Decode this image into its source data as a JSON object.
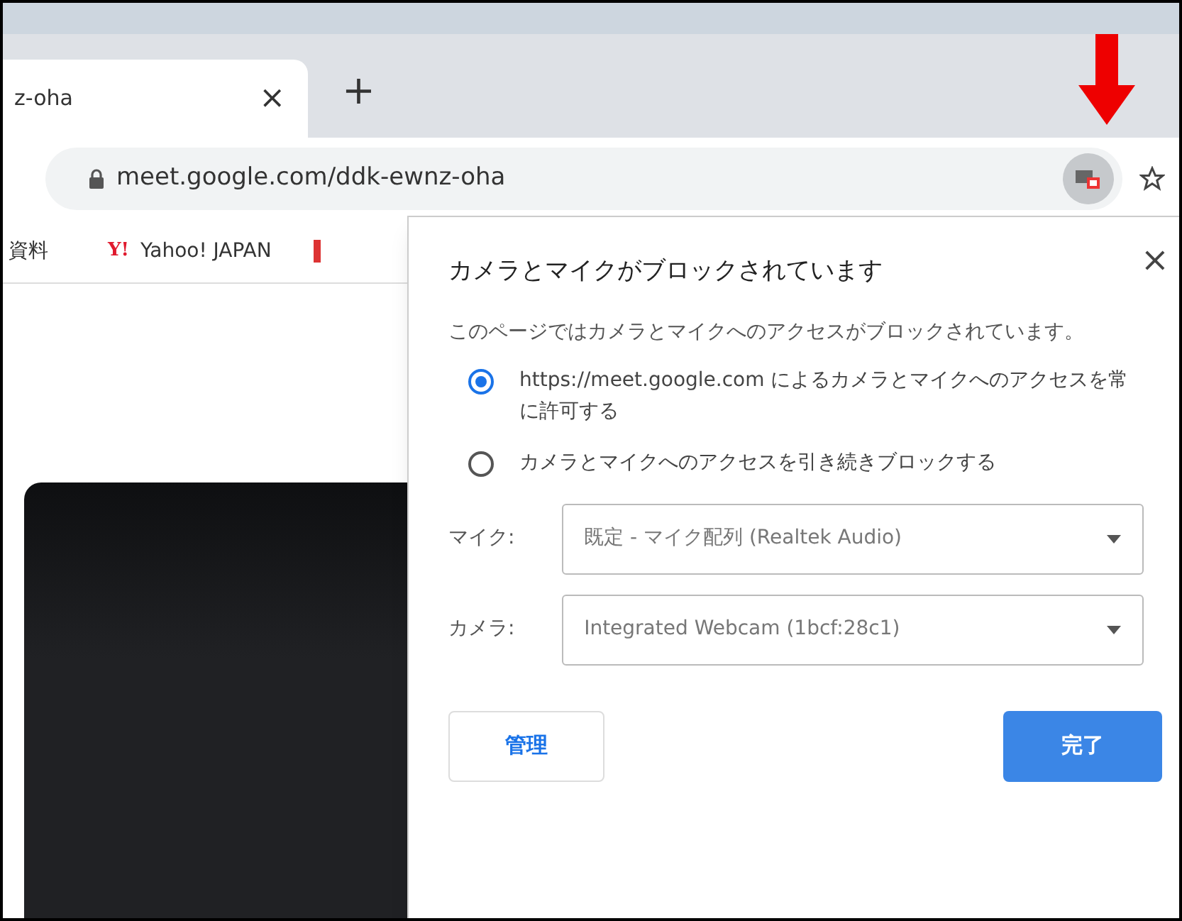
{
  "tab": {
    "title": "z-oha",
    "close": "×",
    "new_tab": "+"
  },
  "address_bar": {
    "url": "meet.google.com/ddk-ewnz-oha",
    "camera_blocked": true
  },
  "bookmarks": [
    {
      "label": "資料",
      "kind": "text"
    },
    {
      "label": "Yahoo! JAPAN",
      "kind": "yahoo",
      "icon_text": "Y!"
    },
    {
      "kind": "cut"
    }
  ],
  "dialog": {
    "title": "カメラとマイクがブロックされています",
    "close": "×",
    "message": "このページではカメラとマイクへのアクセスがブロックされています。",
    "options": [
      {
        "label": "https://meet.google.com によるカメラとマイクへのアクセスを常に許可する",
        "selected": true
      },
      {
        "label": "カメラとマイクへのアクセスを引き続きブロックする",
        "selected": false
      }
    ],
    "devices": [
      {
        "label": "マイク:",
        "value": "既定 - マイク配列 (Realtek Audio)"
      },
      {
        "label": "カメラ:",
        "value": "Integrated Webcam (1bcf:28c1)"
      }
    ],
    "buttons": [
      {
        "label": "管理",
        "kind": "secondary"
      },
      {
        "label": "完了",
        "kind": "primary"
      }
    ]
  }
}
